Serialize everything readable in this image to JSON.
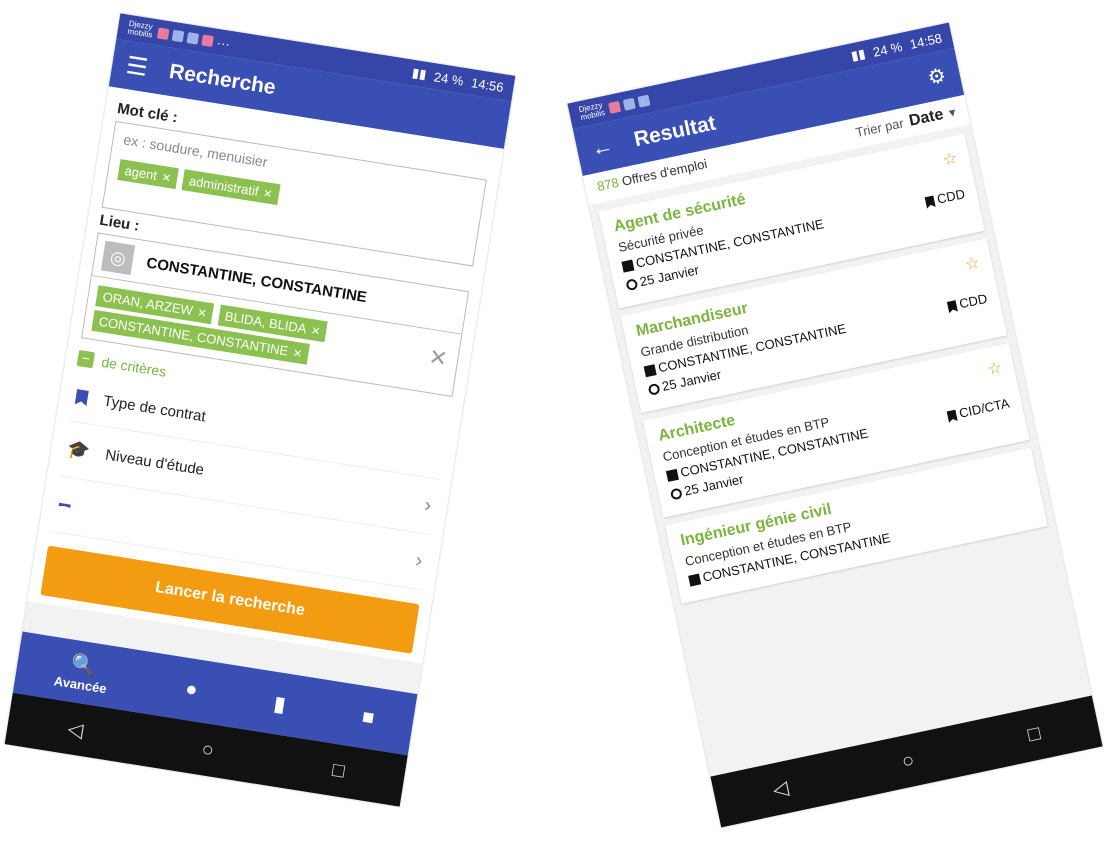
{
  "search_screen": {
    "status": {
      "carrier": "Djezzy mobilis",
      "icons_text": "···",
      "signal": "24 %",
      "time": "14:56"
    },
    "appbar": {
      "title": "Recherche"
    },
    "keyword": {
      "label": "Mot clé :",
      "placeholder": "ex : soudure, menuisier",
      "chips": [
        "agent",
        "administratif"
      ]
    },
    "location": {
      "label": "Lieu :",
      "value": "CONSTANTINE, CONSTANTINE",
      "chips": [
        "ORAN, ARZEW",
        "BLIDA, BLIDA",
        "CONSTANTINE, CONSTANTINE"
      ]
    },
    "criteria_label": "de critères",
    "filters": [
      {
        "label": "Type de contrat"
      },
      {
        "label": "Niveau d'étude"
      },
      {
        "label": ""
      }
    ],
    "search_button": "Lancer la recherche",
    "bottom_nav": {
      "active_label": "Avancée"
    }
  },
  "result_screen": {
    "status": {
      "carrier": "Djezzy mobilis",
      "signal": "24 %",
      "time": "14:58"
    },
    "appbar": {
      "title": "Resultat",
      "sort_label": "Trier par",
      "sort_value": "Date"
    },
    "count": {
      "number": "878",
      "label": "Offres d'emploi"
    },
    "jobs": [
      {
        "title": "Agent de sécurité",
        "sector": "Sécurité privée",
        "location": "CONSTANTINE, CONSTANTINE",
        "contract": "CDD",
        "date": "25 Janvier"
      },
      {
        "title": "Marchandiseur",
        "sector": "Grande distribution",
        "location": "CONSTANTINE, CONSTANTINE",
        "contract": "CDD",
        "date": "25 Janvier"
      },
      {
        "title": "Architecte",
        "sector": "Conception et études en BTP",
        "location": "CONSTANTINE, CONSTANTINE",
        "contract": "CID/CTA",
        "date": "25 Janvier"
      },
      {
        "title": "Ingénieur génie civil",
        "sector": "Conception et études en BTP",
        "location": "CONSTANTINE, CONSTANTINE",
        "contract": "",
        "date": ""
      }
    ]
  },
  "colors": {
    "primary": "#3a4fb3",
    "accent_green": "#8cc152",
    "button_orange": "#f39c12",
    "star": "#d4a017"
  }
}
